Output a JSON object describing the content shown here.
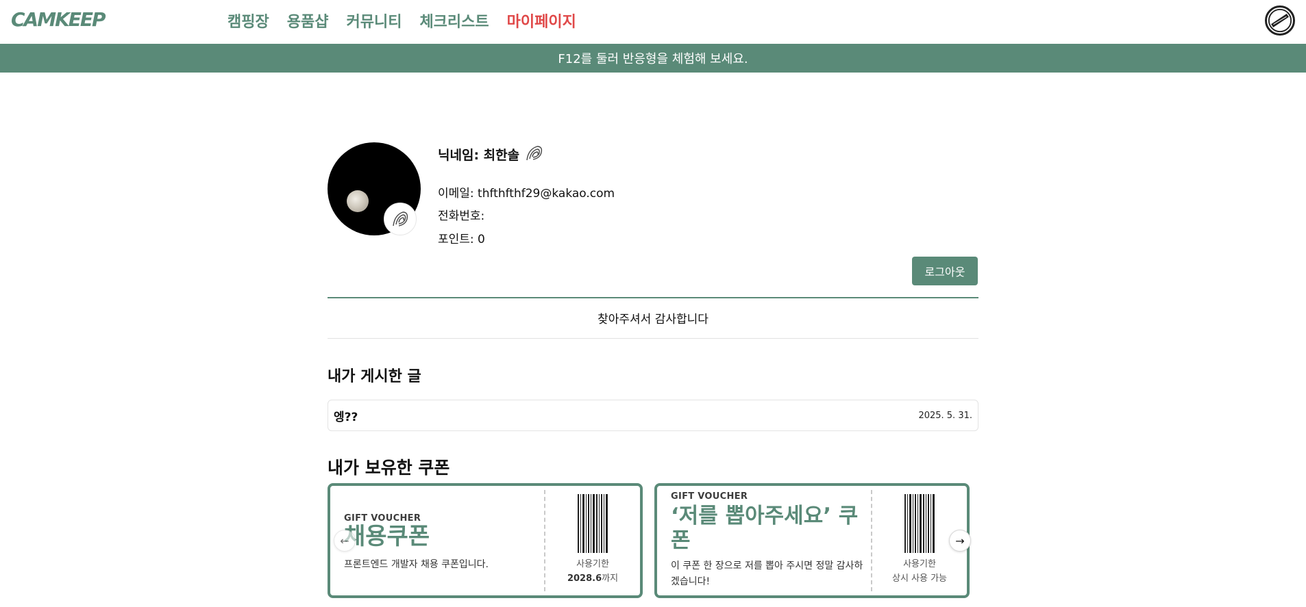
{
  "header": {
    "logo": "CAMKEEP",
    "nav": [
      {
        "label": "캠핑장"
      },
      {
        "label": "용품샵"
      },
      {
        "label": "커뮤니티"
      },
      {
        "label": "체크리스트"
      },
      {
        "label": "마이페이지"
      }
    ],
    "badge_icon": "newbie-badge-icon"
  },
  "banner": {
    "text": "F12를 둘러 반응형을 체험해 보세요."
  },
  "profile": {
    "nickname": "닉네임: 최한솔",
    "email": "이메일: thfthfthf29@kakao.com",
    "phone": "전화번호:",
    "points": "포인트: 0",
    "logout_label": "로그아웃"
  },
  "thanks": "찾아주셔서 감사합니다",
  "posts_section": {
    "title": "내가 게시한 글",
    "posts": [
      {
        "title": "엥??",
        "date": "2025. 5. 31."
      }
    ]
  },
  "coupons_section": {
    "title": "내가 보유한 쿠폰",
    "coupons": [
      {
        "tag": "GIFT VOUCHER",
        "name": "채용쿠폰",
        "desc": "프론트엔드 개발자 채용 쿠폰입니다.",
        "exp_label": "사용기한",
        "exp_bold": "2028.6",
        "exp_suffix": "까지"
      },
      {
        "tag": "GIFT VOUCHER",
        "name": "‘저를 뽑아주세요’ 쿠폰",
        "desc": "이 쿠폰 한 장으로 저를 뽑아 주시면 정말 감사하겠습니다!",
        "exp_label": "사용기한",
        "exp_value": "상시 사용 가능"
      }
    ]
  },
  "colors": {
    "brand": "#5a8a78",
    "active_nav": "#e04848"
  }
}
